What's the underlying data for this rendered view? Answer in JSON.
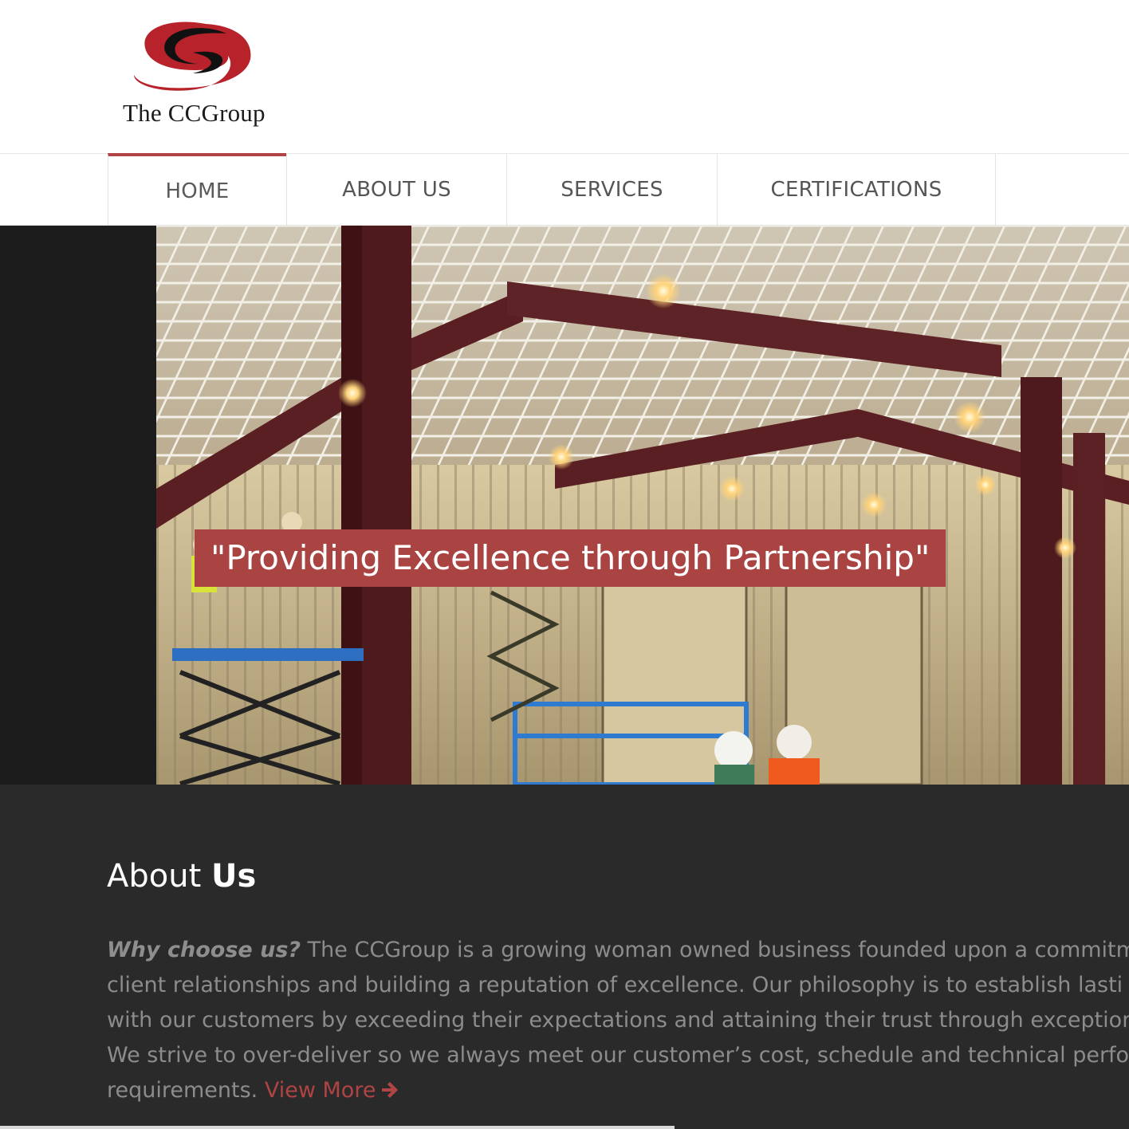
{
  "header": {
    "logo_text": "The CCGroup",
    "logo_icon": "ccgroup-swoosh-logo"
  },
  "nav": {
    "items": [
      {
        "label": "HOME",
        "active": true
      },
      {
        "label": "ABOUT US",
        "active": false
      },
      {
        "label": "SERVICES",
        "active": false
      },
      {
        "label": "CERTIFICATIONS",
        "active": false
      }
    ]
  },
  "hero": {
    "caption": "\"Providing Excellence through Partnership\""
  },
  "about": {
    "title_light": "About",
    "title_bold": "Us",
    "lead": "Why choose us?",
    "lines": [
      "The CCGroup is a growing woman owned business founded upon a commitme",
      "client relationships and building a reputation of excellence. Our philosophy is to establish lasti",
      "with our customers by exceeding their expectations and attaining their trust through exception",
      "We strive to over-deliver so we always meet our customer’s cost, schedule and technical perfor",
      "requirements."
    ],
    "view_more": "View More",
    "view_more_icon": "arrow-right-icon"
  },
  "colors": {
    "accent": "#a94442",
    "about_bg": "#2a2a2a",
    "hero_side": "#1c1c1c",
    "nav_text": "#555555"
  }
}
